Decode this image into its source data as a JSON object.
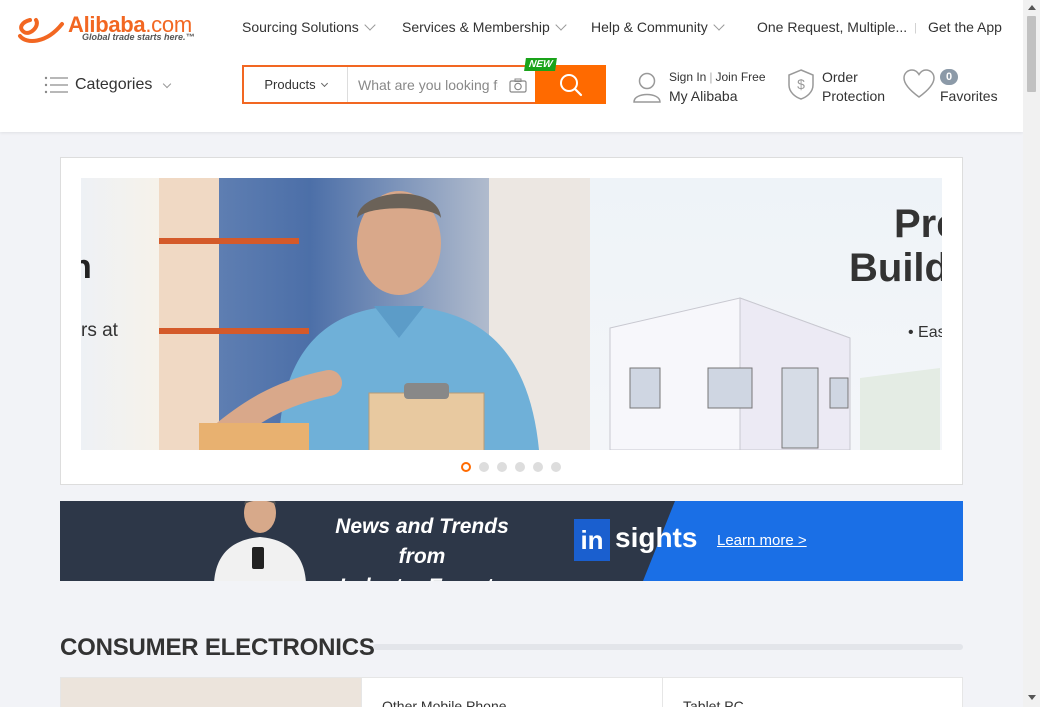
{
  "logo": {
    "word": "Alibaba",
    "dotcom": ".com",
    "tagline": "Global trade starts here.™"
  },
  "topnav": {
    "sourcing": "Sourcing Solutions",
    "services": "Services & Membership",
    "help": "Help & Community",
    "one_request": "One Request, Multiple...",
    "separator": "|",
    "app": "Get the App"
  },
  "categories": {
    "label": "Categories"
  },
  "search": {
    "dropdown": "Products",
    "placeholder": "What are you looking for...",
    "new_badge": "NEW"
  },
  "account": {
    "sign_in": "Sign In",
    "sep": "|",
    "join": "Join Free",
    "my": "My Alibaba"
  },
  "order": {
    "line1": "Order",
    "line2": "Protection"
  },
  "favorites": {
    "count": "0",
    "label": "Favorites"
  },
  "carousel": {
    "left_title": "n",
    "left_sub": "rs at",
    "right_h1": "Pre",
    "right_h2": "Build",
    "right_bullet": "• Eas",
    "dots": 6,
    "active_dot": 0
  },
  "insights": {
    "headline_1": "News and Trends from",
    "headline_2": "Industry Experts",
    "logo_in": "in",
    "logo_sights": "sights",
    "learn_more": "Learn more >"
  },
  "section": {
    "title": "CONSUMER ELECTRONICS",
    "cards": [
      "Other Mobile Phone",
      "Tablet PC"
    ]
  },
  "colors": {
    "accent": "#ff6a00",
    "brand": "#f26722",
    "insights_blue": "#1a6fe6",
    "insights_dark": "#2d3748"
  }
}
